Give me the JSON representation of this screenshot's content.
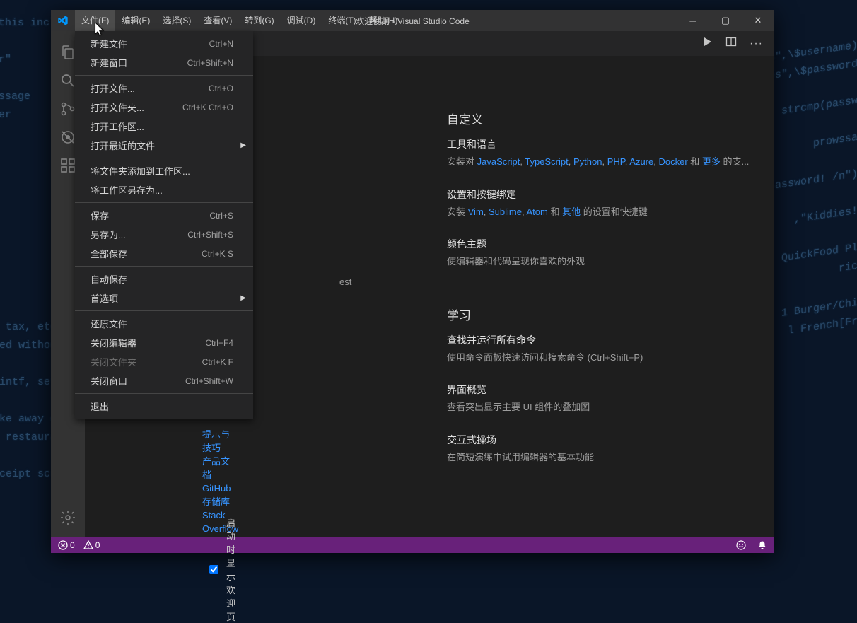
{
  "window": {
    "title": "欢迎使用 - Visual Studio Code"
  },
  "menubar": {
    "items": [
      {
        "label": "文件(F)",
        "active": true
      },
      {
        "label": "编辑(E)"
      },
      {
        "label": "选择(S)"
      },
      {
        "label": "查看(V)"
      },
      {
        "label": "转到(G)"
      },
      {
        "label": "调试(D)"
      },
      {
        "label": "终端(T)"
      },
      {
        "label": "帮助(H)"
      }
    ]
  },
  "file_dropdown": {
    "groups": [
      [
        {
          "label": "新建文件",
          "shortcut": "Ctrl+N",
          "name": "new-file-item"
        },
        {
          "label": "新建窗口",
          "shortcut": "Ctrl+Shift+N",
          "name": "new-window-item"
        }
      ],
      [
        {
          "label": "打开文件...",
          "shortcut": "Ctrl+O",
          "name": "open-file-item"
        },
        {
          "label": "打开文件夹...",
          "shortcut": "Ctrl+K Ctrl+O",
          "name": "open-folder-item"
        },
        {
          "label": "打开工作区...",
          "shortcut": "",
          "name": "open-workspace-item"
        },
        {
          "label": "打开最近的文件",
          "shortcut": "",
          "submenu": true,
          "name": "open-recent-item"
        }
      ],
      [
        {
          "label": "将文件夹添加到工作区...",
          "shortcut": "",
          "name": "add-folder-item"
        },
        {
          "label": "将工作区另存为...",
          "shortcut": "",
          "name": "save-workspace-as-item"
        }
      ],
      [
        {
          "label": "保存",
          "shortcut": "Ctrl+S",
          "name": "save-item"
        },
        {
          "label": "另存为...",
          "shortcut": "Ctrl+Shift+S",
          "name": "save-as-item"
        },
        {
          "label": "全部保存",
          "shortcut": "Ctrl+K S",
          "name": "save-all-item"
        }
      ],
      [
        {
          "label": "自动保存",
          "shortcut": "",
          "name": "autosave-item"
        },
        {
          "label": "首选项",
          "shortcut": "",
          "submenu": true,
          "name": "preferences-item"
        }
      ],
      [
        {
          "label": "还原文件",
          "shortcut": "",
          "name": "revert-file-item"
        },
        {
          "label": "关闭编辑器",
          "shortcut": "Ctrl+F4",
          "name": "close-editor-item"
        },
        {
          "label": "关闭文件夹",
          "shortcut": "Ctrl+K F",
          "disabled": true,
          "name": "close-folder-item"
        },
        {
          "label": "关闭窗口",
          "shortcut": "Ctrl+Shift+W",
          "name": "close-window-item"
        }
      ],
      [
        {
          "label": "退出",
          "shortcut": "",
          "name": "exit-item"
        }
      ]
    ]
  },
  "welcome": {
    "customize_heading": "自定义",
    "learn_heading": "学习",
    "tools": {
      "title": "工具和语言",
      "prefix": "安装对 ",
      "links": [
        "JavaScript",
        "TypeScript",
        "Python",
        "PHP",
        "Azure",
        "Docker"
      ],
      "and": " 和 ",
      "more": "更多",
      "suffix": " 的支..."
    },
    "settings": {
      "title": "设置和按键绑定",
      "prefix": "安装 ",
      "links": [
        "Vim",
        "Sublime",
        "Atom"
      ],
      "and": " 和 ",
      "more": "其他",
      "suffix": " 的设置和快捷键"
    },
    "color": {
      "title": "颜色主题",
      "desc": "使编辑器和代码呈现你喜欢的外观"
    },
    "learn_cmd": {
      "title": "查找并运行所有命令",
      "desc": "使用命令面板快速访问和搜索命令 (Ctrl+Shift+P)"
    },
    "ui": {
      "title": "界面概览",
      "desc": "查看突出显示主要 UI 组件的叠加图"
    },
    "play": {
      "title": "交互式操场",
      "desc": "在简短演练中试用编辑器的基本功能"
    },
    "startup_checkbox": "启动时显示欢迎页"
  },
  "left_peek": {
    "recent_fragment": "est",
    "links": [
      "提示与技巧",
      "产品文档",
      "GitHub 存储库",
      "Stack Overflow"
    ]
  },
  "statusbar": {
    "errors": "0",
    "warnings": "0"
  }
}
